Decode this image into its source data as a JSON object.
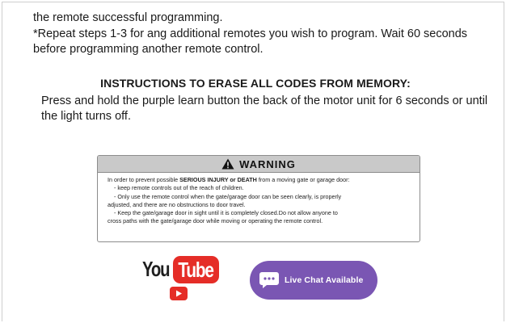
{
  "content": {
    "line1": "the remote successful programming.",
    "line2": "*Repeat steps 1-3 for ang additional remotes you wish to program. Wait 60 seconds before programming another remote control.",
    "erase_heading": "INSTRUCTIONS TO ERASE ALL CODES FROM MEMORY:",
    "erase_text": "Press and hold the purple learn button the back of the motor unit for 6 seconds or until the light turns off."
  },
  "warning": {
    "title": "WARNING",
    "intro_before": "In order to prevent possible ",
    "intro_bold": "SERIOUS INJURY or DEATH",
    "intro_after": " from a moving gate or garage door:",
    "bullet1": "- keep remote controls out of the reach of children.",
    "bullet2": "- Only use the remote control when the gate/garage door can be seen clearly, is properly",
    "bullet2_cont": "adjusted, and there are no obstructions to door travel.",
    "bullet3": "- Keep the gate/garage door in sight until it is completely closed.Do not allow anyone to",
    "bullet3_cont": "cross paths with the gate/garage door while moving or operating the remote control."
  },
  "youtube": {
    "you": "You",
    "tube": "Tube"
  },
  "chat": {
    "label": "Live Chat Available"
  },
  "colors": {
    "youtube_red": "#e52d27",
    "chat_purple": "#7a56b3",
    "warning_header": "#c9c9c9"
  },
  "icons": {
    "warning": "warning-triangle-icon",
    "play": "play-icon",
    "chat": "chat-bubble-icon"
  }
}
